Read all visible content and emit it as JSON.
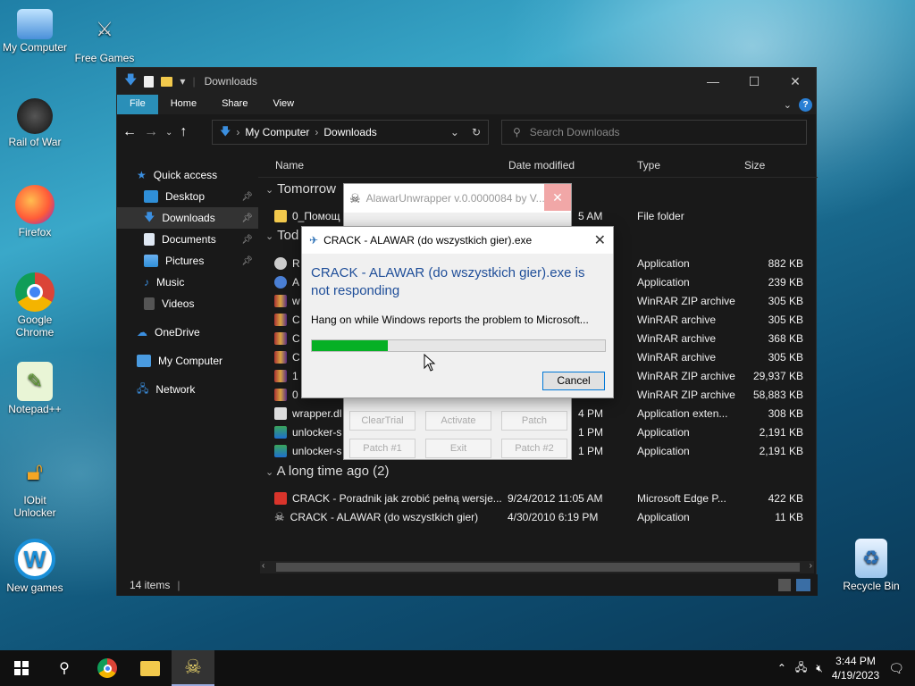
{
  "desktop": {
    "icons": [
      {
        "label": "My Computer"
      },
      {
        "label": "Free Games"
      },
      {
        "label": "Rail of War"
      },
      {
        "label": "Firefox"
      },
      {
        "label": "Google Chrome"
      },
      {
        "label": "Notepad++"
      },
      {
        "label": "IObit Unlocker"
      },
      {
        "label": "New games"
      },
      {
        "label": "Recycle Bin"
      }
    ]
  },
  "explorer": {
    "title": "Downloads",
    "ribbon_tabs": [
      "File",
      "Home",
      "Share",
      "View"
    ],
    "breadcrumb": [
      "My Computer",
      "Downloads"
    ],
    "search_placeholder": "Search Downloads",
    "sidebar": [
      {
        "label": "Quick access"
      },
      {
        "label": "Desktop"
      },
      {
        "label": "Downloads"
      },
      {
        "label": "Documents"
      },
      {
        "label": "Pictures"
      },
      {
        "label": "Music"
      },
      {
        "label": "Videos"
      },
      {
        "label": "OneDrive"
      },
      {
        "label": "My Computer"
      },
      {
        "label": "Network"
      }
    ],
    "columns": {
      "name": "Name",
      "date": "Date modified",
      "type": "Type",
      "size": "Size"
    },
    "groups": {
      "tomorrow": "Tomorrow",
      "today": "Tod",
      "long_ago": "A long time ago (2)"
    },
    "rows": [
      {
        "name": "0_Помощ",
        "date": "5 AM",
        "type": "File folder",
        "size": ""
      },
      {
        "name": "R",
        "date": "",
        "type": "Application",
        "size": "882 KB"
      },
      {
        "name": "A",
        "date": "",
        "type": "Application",
        "size": "239 KB"
      },
      {
        "name": "w",
        "date": "",
        "type": "WinRAR ZIP archive",
        "size": "305 KB"
      },
      {
        "name": "C",
        "date": "",
        "type": "WinRAR archive",
        "size": "305 KB"
      },
      {
        "name": "C",
        "date": "",
        "type": "WinRAR archive",
        "size": "368 KB"
      },
      {
        "name": "C",
        "date": "",
        "type": "WinRAR archive",
        "size": "305 KB"
      },
      {
        "name": "1",
        "date": "",
        "type": "WinRAR ZIP archive",
        "size": "29,937 KB"
      },
      {
        "name": "0",
        "date": "",
        "type": "WinRAR ZIP archive",
        "size": "58,883 KB"
      },
      {
        "name": "wrapper.dl",
        "date": "4 PM",
        "type": "Application exten...",
        "size": "308 KB"
      },
      {
        "name": "unlocker-s",
        "date": "1 PM",
        "type": "Application",
        "size": "2,191 KB"
      },
      {
        "name": "unlocker-s",
        "date": "1 PM",
        "type": "Application",
        "size": "2,191 KB"
      },
      {
        "name": "CRACK - Poradnik jak zrobić pełną wersje...",
        "date": "9/24/2012 11:05 AM",
        "type": "Microsoft Edge P...",
        "size": "422 KB"
      },
      {
        "name": "CRACK - ALAWAR (do wszystkich gier)",
        "date": "4/30/2010 6:19 PM",
        "type": "Application",
        "size": "11 KB"
      }
    ],
    "status": "14 items"
  },
  "alawar": {
    "title": "AlawarUnwrapper v.0.0000084 by V...",
    "buttons": [
      "ClearTrial",
      "Activate",
      "Patch",
      "Patch #1",
      "Exit",
      "Patch #2"
    ]
  },
  "dialog": {
    "title": "CRACK - ALAWAR (do wszystkich gier).exe",
    "heading": "CRACK - ALAWAR (do wszystkich gier).exe is not responding",
    "message": "Hang on while Windows reports the problem to Microsoft...",
    "progress": 0.26,
    "cancel_label": "Cancel"
  },
  "taskbar": {
    "time": "3:44 PM",
    "date": "4/19/2023"
  },
  "colors": {
    "accent": "#2a8fb8",
    "progress": "#06b025",
    "heading_blue": "#1f4e99"
  }
}
